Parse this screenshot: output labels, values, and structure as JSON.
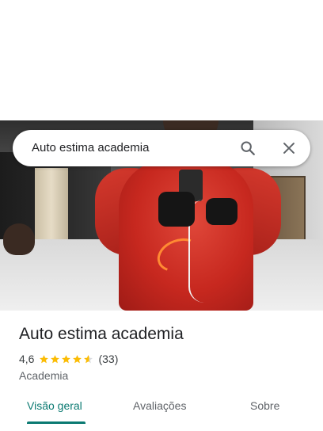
{
  "search": {
    "query": "Auto estima academia",
    "search_icon": "search-icon",
    "close_icon": "close-icon"
  },
  "photo": {
    "description_icon": "place-photo"
  },
  "place": {
    "title": "Auto estima academia",
    "rating": "4,6",
    "rating_value": 4.6,
    "stars_max": 5,
    "review_count": "(33)",
    "category": "Academia"
  },
  "tabs": [
    {
      "label": "Visão geral",
      "active": true
    },
    {
      "label": "Avaliações",
      "active": false
    },
    {
      "label": "Sobre",
      "active": false
    }
  ],
  "colors": {
    "accent": "#0b7a72",
    "star": "#fbbc04",
    "star_empty": "#dadce0"
  }
}
